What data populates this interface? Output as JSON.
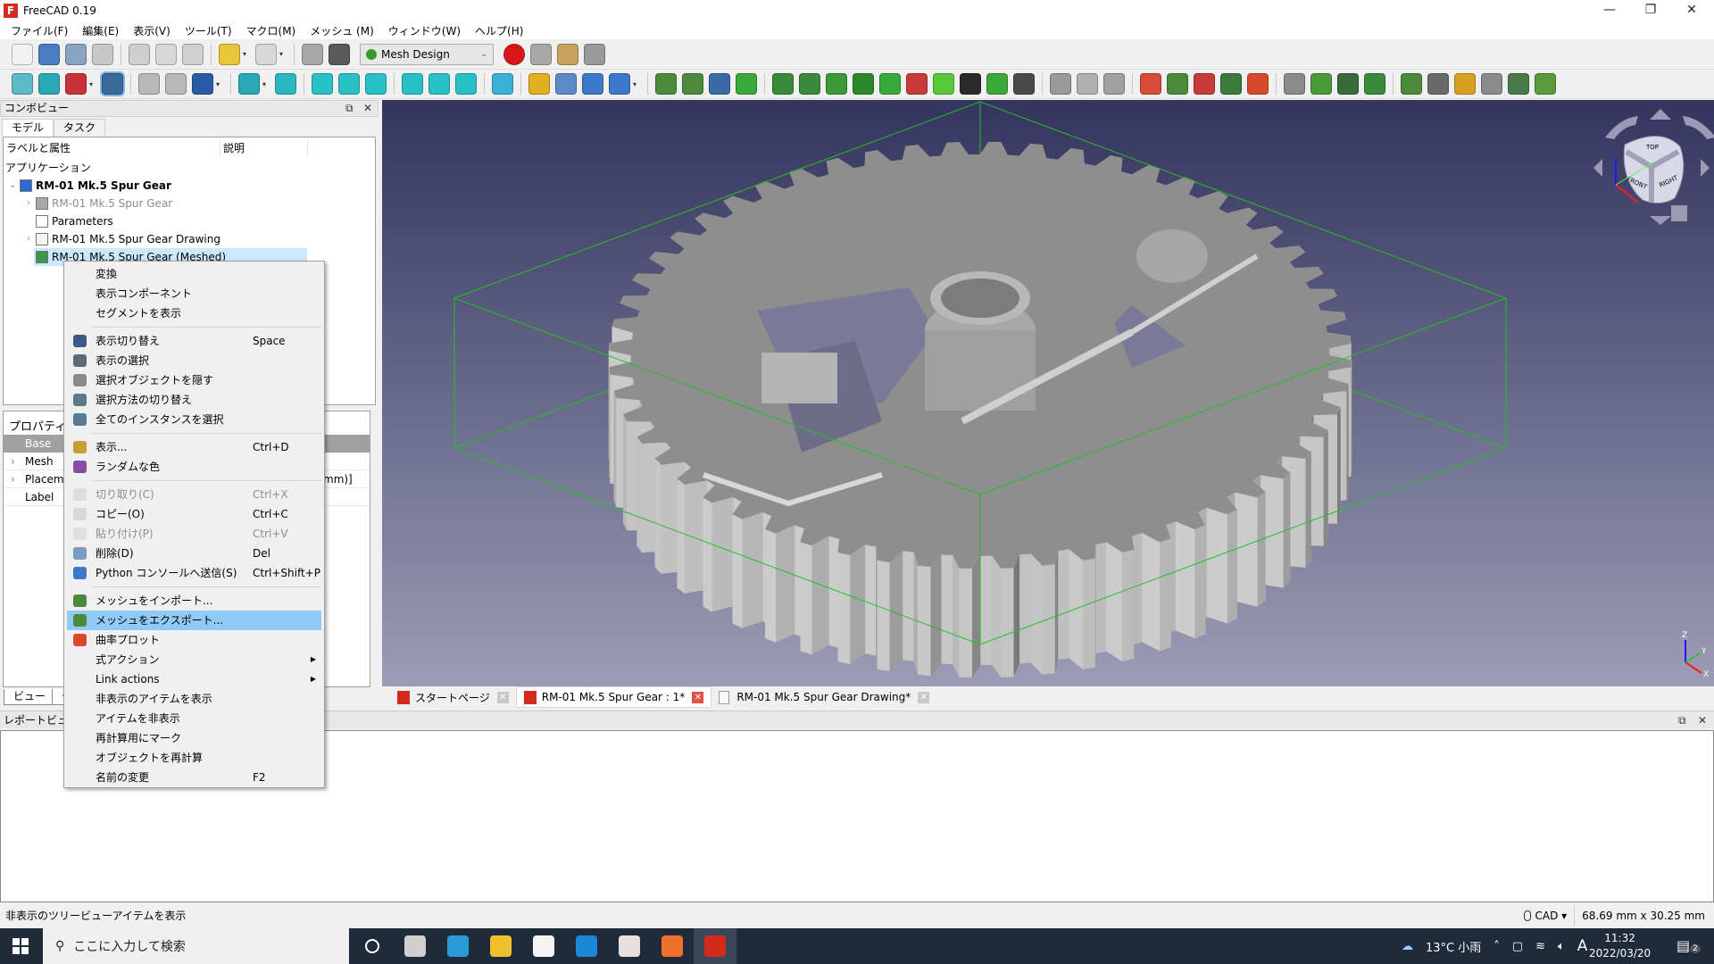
{
  "window": {
    "title": "FreeCAD 0.19",
    "minimize": "—",
    "maximize": "❐",
    "close": "✕"
  },
  "menubar": [
    "ファイル(F)",
    "編集(E)",
    "表示(V)",
    "ツール(T)",
    "マクロ(M)",
    "メッシュ (M)",
    "ウィンドウ(W)",
    "ヘルプ(H)"
  ],
  "toolbar1": {
    "left": [
      {
        "name": "new-document-icon",
        "color": "#f2f2f2"
      },
      {
        "name": "open-folder-icon",
        "color": "#4b7cc3"
      },
      {
        "name": "save-icon",
        "color": "#8aa3c0"
      },
      {
        "name": "save-as-icon",
        "color": "#c8c8c8"
      },
      {
        "sep": true
      },
      {
        "name": "cut-icon",
        "color": "#cfcfcf"
      },
      {
        "name": "copy-icon",
        "color": "#d8d8d8"
      },
      {
        "name": "paste-icon",
        "color": "#d0d0d0"
      },
      {
        "sep": true
      },
      {
        "name": "undo-icon",
        "color": "#e8c53a",
        "dd": true
      },
      {
        "name": "redo-icon",
        "color": "#d8d8d8",
        "dd": true
      },
      {
        "sep": true
      },
      {
        "name": "refresh-icon",
        "color": "#a8a8a8"
      },
      {
        "name": "whats-this-icon",
        "color": "#5a5a5a"
      }
    ],
    "workbench": "Mesh Design",
    "right": [
      {
        "name": "macro-record-icon",
        "color": "#d81818",
        "round": true
      },
      {
        "name": "macro-stop-icon",
        "color": "#a8a8a8"
      },
      {
        "name": "macro-edit-icon",
        "color": "#c8a060"
      },
      {
        "name": "macro-run-icon",
        "color": "#9a9a9a"
      }
    ]
  },
  "toolbar2": [
    {
      "name": "fit-all-icon",
      "color": "#5fb8c8"
    },
    {
      "name": "fit-selection-icon",
      "color": "#2aa8b8"
    },
    {
      "name": "draw-style-icon",
      "color": "#c8303a",
      "dd": true
    },
    {
      "name": "bounding-box-icon",
      "color": "#3a6a9a",
      "active": true
    },
    {
      "sep": true
    },
    {
      "name": "back-icon",
      "color": "#b8b8b8"
    },
    {
      "name": "forward-icon",
      "color": "#b8b8b8"
    },
    {
      "name": "std-views-icon",
      "color": "#2a5aa8",
      "dd": true
    },
    {
      "sep": true
    },
    {
      "name": "zoom-icon",
      "color": "#2aa8b8",
      "dd": true
    },
    {
      "name": "isometric-view-icon",
      "color": "#2ab8c0"
    },
    {
      "sep": true
    },
    {
      "name": "front-view-icon",
      "color": "#2ac0c8"
    },
    {
      "name": "top-view-icon",
      "color": "#2ac0c8"
    },
    {
      "name": "right-view-icon",
      "color": "#2ac0c8"
    },
    {
      "sep": true
    },
    {
      "name": "rear-view-icon",
      "color": "#2ac0c8"
    },
    {
      "name": "bottom-view-icon",
      "color": "#2ac0c8"
    },
    {
      "name": "left-view-icon",
      "color": "#2ac0c8"
    },
    {
      "sep": true
    },
    {
      "name": "measure-distance-icon",
      "color": "#3ab0d8"
    },
    {
      "sep": true
    },
    {
      "name": "part-icon",
      "color": "#e0b020"
    },
    {
      "name": "group-icon",
      "color": "#5a8ac8"
    },
    {
      "name": "link-icon",
      "color": "#3a7ac8",
      "dd": false
    },
    {
      "name": "link-actions-icon",
      "color": "#3a7ac8",
      "dd": true
    },
    {
      "sep": true
    },
    {
      "name": "mesh-import-icon",
      "color": "#4a8a3a"
    },
    {
      "name": "mesh-export-icon",
      "color": "#4a8a3a"
    },
    {
      "name": "mesh-from-shape-icon",
      "color": "#3a6aa8"
    },
    {
      "name": "mesh-remesh-icon",
      "color": "#3aa83a"
    },
    {
      "sep": true
    },
    {
      "name": "mesh-evaluate-icon",
      "color": "#3a8a3a"
    },
    {
      "name": "mesh-harmonize-icon",
      "color": "#3a8a3a"
    },
    {
      "name": "mesh-fill-holes-icon",
      "color": "#3a9a3a"
    },
    {
      "name": "mesh-flip-normals-icon",
      "color": "#2a8a2a"
    },
    {
      "name": "mesh-add-facet-icon",
      "color": "#3aa83a"
    },
    {
      "name": "mesh-remove-components-icon",
      "color": "#c83a3a"
    },
    {
      "name": "mesh-sphere-icon",
      "color": "#5ac83a"
    },
    {
      "name": "mesh-cone-icon",
      "color": "#2a2a2a"
    },
    {
      "name": "mesh-smooth-icon",
      "color": "#3aa83a"
    },
    {
      "name": "mesh-scale-icon",
      "color": "#4a4a4a"
    },
    {
      "sep": true
    },
    {
      "name": "mesh-union-icon",
      "color": "#9a9a9a"
    },
    {
      "name": "mesh-intersection-icon",
      "color": "#b0b0b0"
    },
    {
      "name": "mesh-difference-icon",
      "color": "#a0a0a0"
    },
    {
      "sep": true
    },
    {
      "name": "mesh-cut-icon",
      "color": "#d84a3a"
    },
    {
      "name": "mesh-trim-icon",
      "color": "#4a8a3a"
    },
    {
      "name": "mesh-section-icon",
      "color": "#c83a3a"
    },
    {
      "name": "mesh-cross-sections-icon",
      "color": "#3a7a3a"
    },
    {
      "name": "mesh-split-icon",
      "color": "#d84a2a"
    },
    {
      "sep": true
    },
    {
      "name": "mesh-segmentation-icon",
      "color": "#8a8a8a"
    },
    {
      "name": "mesh-segment-best-fit-icon",
      "color": "#4a9a3a"
    },
    {
      "name": "mesh-merge-icon",
      "color": "#3a6a3a"
    },
    {
      "name": "mesh-decimate-icon",
      "color": "#3a8a3a"
    },
    {
      "sep": true
    },
    {
      "name": "mesh-build-region-icon",
      "color": "#4a8a3a"
    },
    {
      "name": "mesh-pick-icon",
      "color": "#6a6a6a"
    },
    {
      "name": "curvature-plot-icon",
      "color": "#d8a020"
    },
    {
      "name": "curvature-info-icon",
      "color": "#8a8a8a"
    },
    {
      "name": "mesh-poly-select-icon",
      "color": "#4a7a4a"
    },
    {
      "name": "mesh-poly-segm-icon",
      "color": "#5a9a3a"
    }
  ],
  "combo_view": {
    "title": "コンボビュー",
    "tabs": [
      "モデル",
      "タスク"
    ],
    "tree_header": [
      "ラベルと属性",
      "説明"
    ],
    "tree": [
      {
        "label": "アプリケーション",
        "level": 0
      },
      {
        "label": "RM-01 Mk.5 Spur Gear",
        "level": 1,
        "expanded": true,
        "bold": true,
        "icon": "document-icon",
        "color": "#2a6ad0"
      },
      {
        "label": "RM-01 Mk.5 Spur Gear",
        "level": 2,
        "collapsed": true,
        "dim": true,
        "icon": "body-icon",
        "color": "#a8a8a8"
      },
      {
        "label": "Parameters",
        "level": 2,
        "icon": "spreadsheet-icon",
        "color": "#ffffff"
      },
      {
        "label": "RM-01 Mk.5 Spur Gear Drawing",
        "level": 2,
        "collapsed": true,
        "icon": "drawing-page-icon",
        "color": "#f4f4f4"
      },
      {
        "label": "RM-01 Mk.5 Spur Gear (Meshed)",
        "level": 2,
        "selected": true,
        "icon": "mesh-icon",
        "color": "#3a9a4a"
      }
    ],
    "properties": {
      "title": "プロパティ",
      "group": "Base",
      "rows": [
        {
          "name": "Mesh",
          "value": ""
        },
        {
          "name": "Placement",
          "value": "mm)]"
        },
        {
          "name": "Label",
          "value": ""
        }
      ]
    },
    "view_tabs": [
      "ビュー",
      "データ"
    ]
  },
  "context_menu": [
    {
      "label": "変換"
    },
    {
      "label": "表示コンポーネント"
    },
    {
      "label": "セグメントを表示"
    },
    {
      "sep": true
    },
    {
      "label": "表示切り替え",
      "shortcut": "Space",
      "icon": "eye-icon",
      "color": "#3a5a8a"
    },
    {
      "label": "表示の選択",
      "icon": "show-selection-icon",
      "color": "#5a6a7a"
    },
    {
      "label": "選択オブジェクトを隠す",
      "icon": "hide-selection-icon",
      "color": "#8a8a8a"
    },
    {
      "label": "選択方法の切り替え",
      "icon": "selection-arrow-icon",
      "color": "#5a7a8a"
    },
    {
      "label": "全てのインスタンスを選択",
      "icon": "select-instances-icon",
      "color": "#5a7a9a"
    },
    {
      "sep": true
    },
    {
      "label": "表示...",
      "shortcut": "Ctrl+D",
      "icon": "display-properties-icon",
      "color": "#c8a030"
    },
    {
      "label": "ランダムな色",
      "icon": "random-color-icon",
      "color": "#8a4aa8"
    },
    {
      "sep": true
    },
    {
      "label": "切り取り(C)",
      "shortcut": "Ctrl+X",
      "disabled": true,
      "icon": "cut-icon",
      "color": "#c8c8c8"
    },
    {
      "label": "コピー(O)",
      "shortcut": "Ctrl+C",
      "icon": "copy-icon",
      "color": "#d8d8d8"
    },
    {
      "label": "貼り付け(P)",
      "shortcut": "Ctrl+V",
      "disabled": true,
      "icon": "paste-icon",
      "color": "#d0d0d0"
    },
    {
      "label": "削除(D)",
      "shortcut": "Del",
      "icon": "delete-icon",
      "color": "#7a9ac0"
    },
    {
      "label": "Python コンソールへ送信(S)",
      "shortcut": "Ctrl+Shift+P",
      "icon": "python-icon",
      "color": "#3a7ac8"
    },
    {
      "sep": true
    },
    {
      "label": "メッシュをインポート...",
      "icon": "mesh-import-icon",
      "color": "#4a8a3a"
    },
    {
      "label": "メッシュをエクスポート...",
      "icon": "mesh-export-icon",
      "color": "#4a8a3a",
      "highlight": true
    },
    {
      "label": "曲率プロット",
      "icon": "curvature-plot-icon",
      "color": "#d84a2a"
    },
    {
      "label": "式アクション",
      "submenu": true
    },
    {
      "label": "Link actions",
      "submenu": true
    },
    {
      "label": "非表示のアイテムを表示"
    },
    {
      "label": "アイテムを非表示"
    },
    {
      "label": "再計算用にマーク"
    },
    {
      "label": "オブジェクトを再計算"
    },
    {
      "label": "名前の変更",
      "shortcut": "F2"
    }
  ],
  "navcube": {
    "faces": [
      "TOP",
      "FRONT",
      "RIGHT"
    ],
    "axes": [
      "X",
      "Y",
      "Z"
    ]
  },
  "doc_tabs": [
    {
      "label": "スタートページ",
      "icon": "freecad-icon"
    },
    {
      "label": "RM-01 Mk.5 Spur Gear : 1*",
      "icon": "freecad-icon",
      "active": true
    },
    {
      "label": "RM-01 Mk.5 Spur Gear Drawing*",
      "icon": "page-icon"
    }
  ],
  "report_view": {
    "title": "レポートビュー"
  },
  "status": {
    "message": "非表示のツリービューアイテムを表示",
    "nav_style": "CAD",
    "dimensions": "68.69 mm x 30.25 mm"
  },
  "taskbar": {
    "search_placeholder": "ここに入力して検索",
    "apps": [
      {
        "name": "cortana-icon",
        "color": "#ffffff"
      },
      {
        "name": "task-view-icon",
        "color": "#cfcfcf"
      },
      {
        "name": "edge-icon",
        "color": "#2a9ad8"
      },
      {
        "name": "file-explorer-icon",
        "color": "#f0c030"
      },
      {
        "name": "store-icon",
        "color": "#f4f4f4"
      },
      {
        "name": "mail-icon",
        "color": "#1a8ad8"
      },
      {
        "name": "snip-icon",
        "color": "#e8e0e0"
      },
      {
        "name": "firefox-icon",
        "color": "#f0702a"
      },
      {
        "name": "freecad-icon",
        "color": "#d42a1e"
      }
    ],
    "weather": "13°C  小雨",
    "time": "11:32",
    "date": "2022/03/20",
    "notifications": "2",
    "ime": "A"
  },
  "colors": {
    "selection": "#cce8ff",
    "menu_highlight": "#91c9f7",
    "bbox": "#22c022",
    "viewport_top": "#34345e",
    "viewport_bottom": "#9c9cb6"
  }
}
